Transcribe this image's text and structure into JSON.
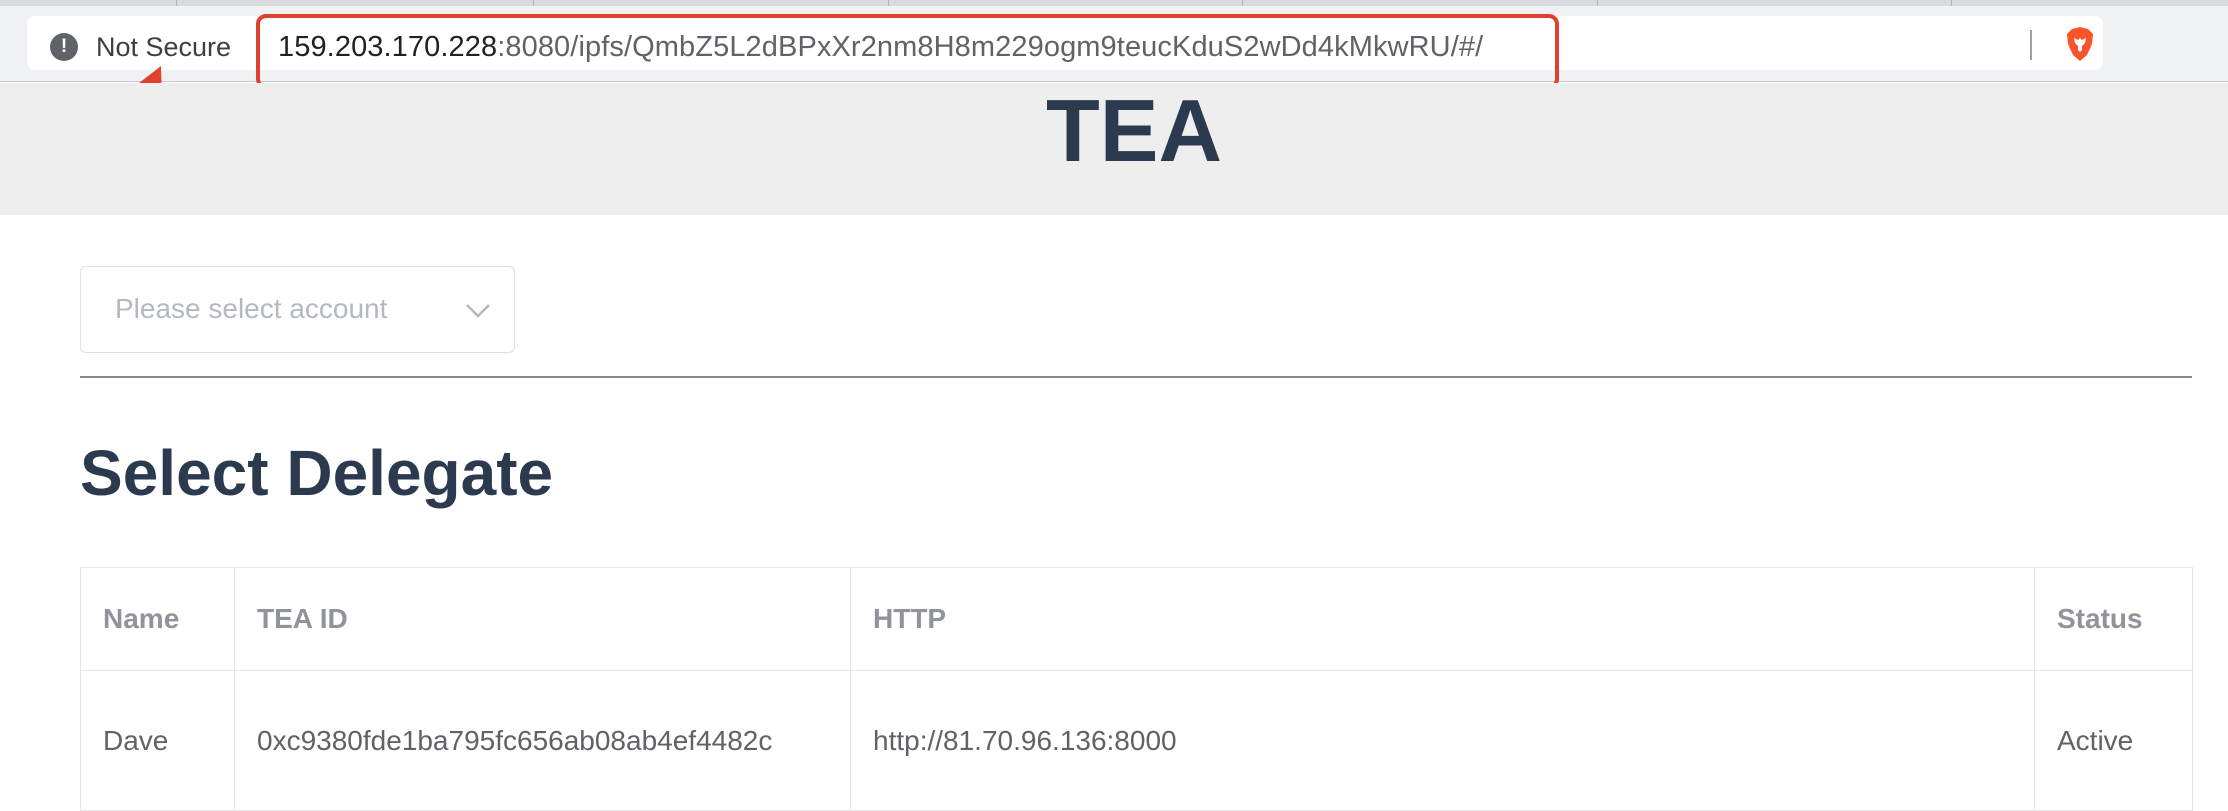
{
  "browser": {
    "security_label": "Not Secure",
    "url_host": "159.203.170.228",
    "url_rest": ":8080/ipfs/QmbZ5L2dBPxXr2nm8H8m229ogm9teucKduS2wDd4kMkwRU/#/",
    "security_icon": "info-icon",
    "extension_icon": "brave-lion-icon"
  },
  "annotation": {
    "color": "#e0402e"
  },
  "header": {
    "title": "TEA"
  },
  "account_select": {
    "placeholder": "Please select account"
  },
  "section": {
    "title": "Select Delegate"
  },
  "table": {
    "columns": [
      "Name",
      "TEA ID",
      "HTTP",
      "Status"
    ],
    "rows": [
      {
        "name": "Dave",
        "tea_id": "0xc9380fde1ba795fc656ab08ab4ef4482c",
        "http": "http://81.70.96.136:8000",
        "status": "Active"
      }
    ]
  },
  "colors": {
    "heading": "#2c3a4f",
    "header_bg": "#eeeeee",
    "annotation": "#e0402e"
  }
}
